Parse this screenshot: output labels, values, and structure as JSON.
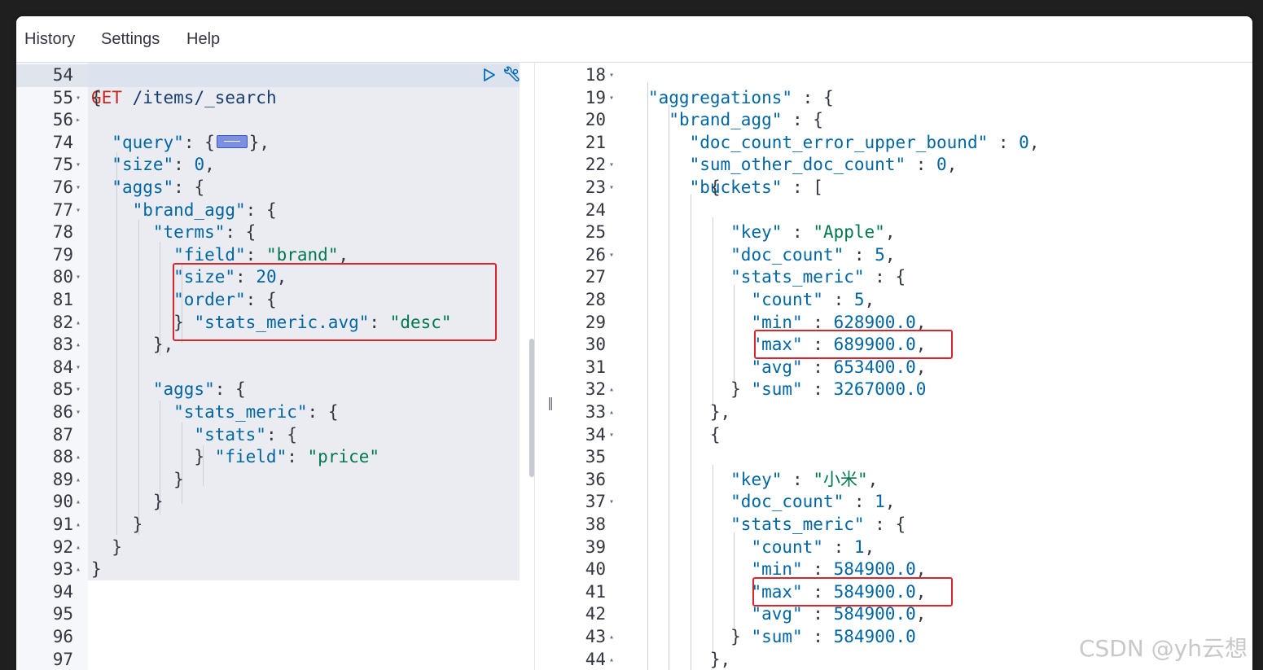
{
  "menu": {
    "history": "History",
    "settings": "Settings",
    "help": "Help"
  },
  "request": {
    "method": "GET",
    "path": "/items/_search",
    "lines": [
      {
        "n": "54",
        "fold": ""
      },
      {
        "n": "55",
        "fold": "▾"
      },
      {
        "n": "56",
        "fold": "▸"
      },
      {
        "n": "74",
        "fold": ""
      },
      {
        "n": "75",
        "fold": "▾"
      },
      {
        "n": "76",
        "fold": "▾"
      },
      {
        "n": "77",
        "fold": "▾"
      },
      {
        "n": "78",
        "fold": ""
      },
      {
        "n": "79",
        "fold": ""
      },
      {
        "n": "80",
        "fold": "▾"
      },
      {
        "n": "81",
        "fold": ""
      },
      {
        "n": "82",
        "fold": "▴"
      },
      {
        "n": "83",
        "fold": "▴"
      },
      {
        "n": "84",
        "fold": "▾"
      },
      {
        "n": "85",
        "fold": "▾"
      },
      {
        "n": "86",
        "fold": "▾"
      },
      {
        "n": "87",
        "fold": ""
      },
      {
        "n": "88",
        "fold": "▴"
      },
      {
        "n": "89",
        "fold": "▴"
      },
      {
        "n": "90",
        "fold": "▴"
      },
      {
        "n": "91",
        "fold": "▴"
      },
      {
        "n": "92",
        "fold": "▴"
      },
      {
        "n": "93",
        "fold": "▴"
      },
      {
        "n": "94",
        "fold": ""
      },
      {
        "n": "95",
        "fold": ""
      },
      {
        "n": "96",
        "fold": ""
      },
      {
        "n": "97",
        "fold": ""
      }
    ],
    "keys": {
      "query": "\"query\"",
      "size": "\"size\"",
      "aggs": "\"aggs\"",
      "brand_agg": "\"brand_agg\"",
      "terms": "\"terms\"",
      "field": "\"field\"",
      "order": "\"order\"",
      "order_key": "\"stats_meric.avg\"",
      "stats_meric": "\"stats_meric\"",
      "stats": "\"stats\""
    },
    "values": {
      "size_0": "0",
      "brand": "\"brand\"",
      "size_20": "20",
      "desc": "\"desc\"",
      "price": "\"price\""
    }
  },
  "response": {
    "lines": [
      {
        "n": "18",
        "fold": "▾"
      },
      {
        "n": "19",
        "fold": "▾"
      },
      {
        "n": "20",
        "fold": ""
      },
      {
        "n": "21",
        "fold": ""
      },
      {
        "n": "22",
        "fold": "▾"
      },
      {
        "n": "23",
        "fold": "▾"
      },
      {
        "n": "24",
        "fold": ""
      },
      {
        "n": "25",
        "fold": ""
      },
      {
        "n": "26",
        "fold": "▾"
      },
      {
        "n": "27",
        "fold": ""
      },
      {
        "n": "28",
        "fold": ""
      },
      {
        "n": "29",
        "fold": ""
      },
      {
        "n": "30",
        "fold": ""
      },
      {
        "n": "31",
        "fold": ""
      },
      {
        "n": "32",
        "fold": "▴"
      },
      {
        "n": "33",
        "fold": "▴"
      },
      {
        "n": "34",
        "fold": "▾"
      },
      {
        "n": "35",
        "fold": ""
      },
      {
        "n": "36",
        "fold": ""
      },
      {
        "n": "37",
        "fold": "▾"
      },
      {
        "n": "38",
        "fold": ""
      },
      {
        "n": "39",
        "fold": ""
      },
      {
        "n": "40",
        "fold": ""
      },
      {
        "n": "41",
        "fold": ""
      },
      {
        "n": "42",
        "fold": ""
      },
      {
        "n": "43",
        "fold": "▴"
      },
      {
        "n": "44",
        "fold": "▴"
      }
    ],
    "keys": {
      "aggregations": "\"aggregations\"",
      "brand_agg": "\"brand_agg\"",
      "error_bound": "\"doc_count_error_upper_bound\"",
      "sum_other": "\"sum_other_doc_count\"",
      "buckets": "\"buckets\"",
      "key": "\"key\"",
      "doc_count": "\"doc_count\"",
      "stats_meric": "\"stats_meric\"",
      "count": "\"count\"",
      "min": "\"min\"",
      "max": "\"max\"",
      "avg": "\"avg\"",
      "sum": "\"sum\""
    },
    "values": {
      "zero": "0",
      "apple": "\"Apple\"",
      "xiaomi": "\"小米\"",
      "b1_doc_count": "5",
      "b1_count": "5",
      "b1_min": "628900.0",
      "b1_max": "689900.0",
      "b1_avg": "653400.0",
      "b1_sum": "3267000.0",
      "b2_doc_count": "1",
      "b2_count": "1",
      "b2_min": "584900.0",
      "b2_max": "584900.0",
      "b2_avg": "584900.0",
      "b2_sum": "584900.0"
    }
  },
  "watermark": "CSDN @yh云想",
  "colors": {
    "key": "#0066a3",
    "string": "#00784d",
    "method": "#c4291f",
    "highlight": "#d9262c"
  },
  "icons": [
    "play-icon",
    "wrench-icon"
  ]
}
